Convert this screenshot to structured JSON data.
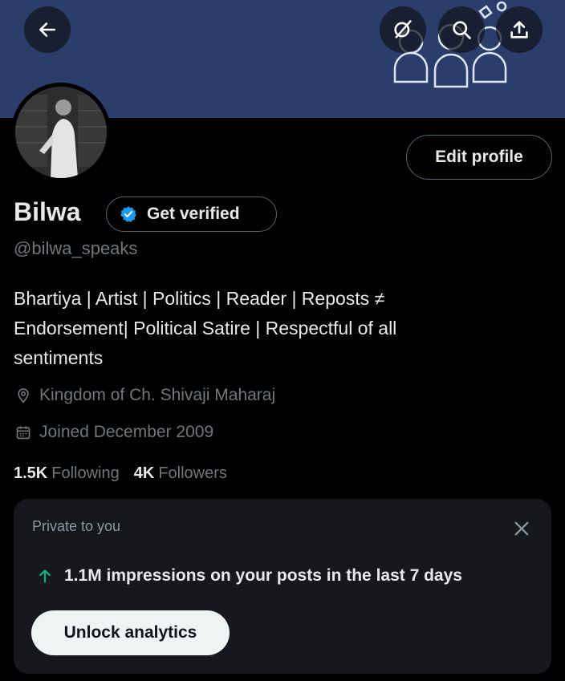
{
  "header": {
    "back_icon": "arrow-left-icon",
    "grok_icon": "grok-icon",
    "search_icon": "search-icon",
    "share_icon": "share-icon"
  },
  "profile": {
    "name": "Bilwa",
    "verify_label": "Get verified",
    "handle": "@bilwa_speaks",
    "edit_label": "Edit profile",
    "bio_lines": [
      "Bhartiya | Artist | Politics | Reader | Reposts ≠",
      "Endorsement| Political Satire | Respectful of all",
      "sentiments"
    ],
    "location": "Kingdom of Ch. Shivaji Maharaj",
    "joined": "Joined December 2009",
    "following_count": "1.5K",
    "following_label": "Following",
    "followers_count": "4K",
    "followers_label": "Followers"
  },
  "analytics_card": {
    "private_label": "Private to you",
    "impressions_text": "1.1M impressions on your posts in the last 7 days",
    "unlock_label": "Unlock analytics"
  },
  "colors": {
    "banner": "#2b3d6b",
    "background": "#000000",
    "verified_blue": "#1d9bf0",
    "growth_green": "#00ba7c",
    "muted_text": "#71767b"
  }
}
